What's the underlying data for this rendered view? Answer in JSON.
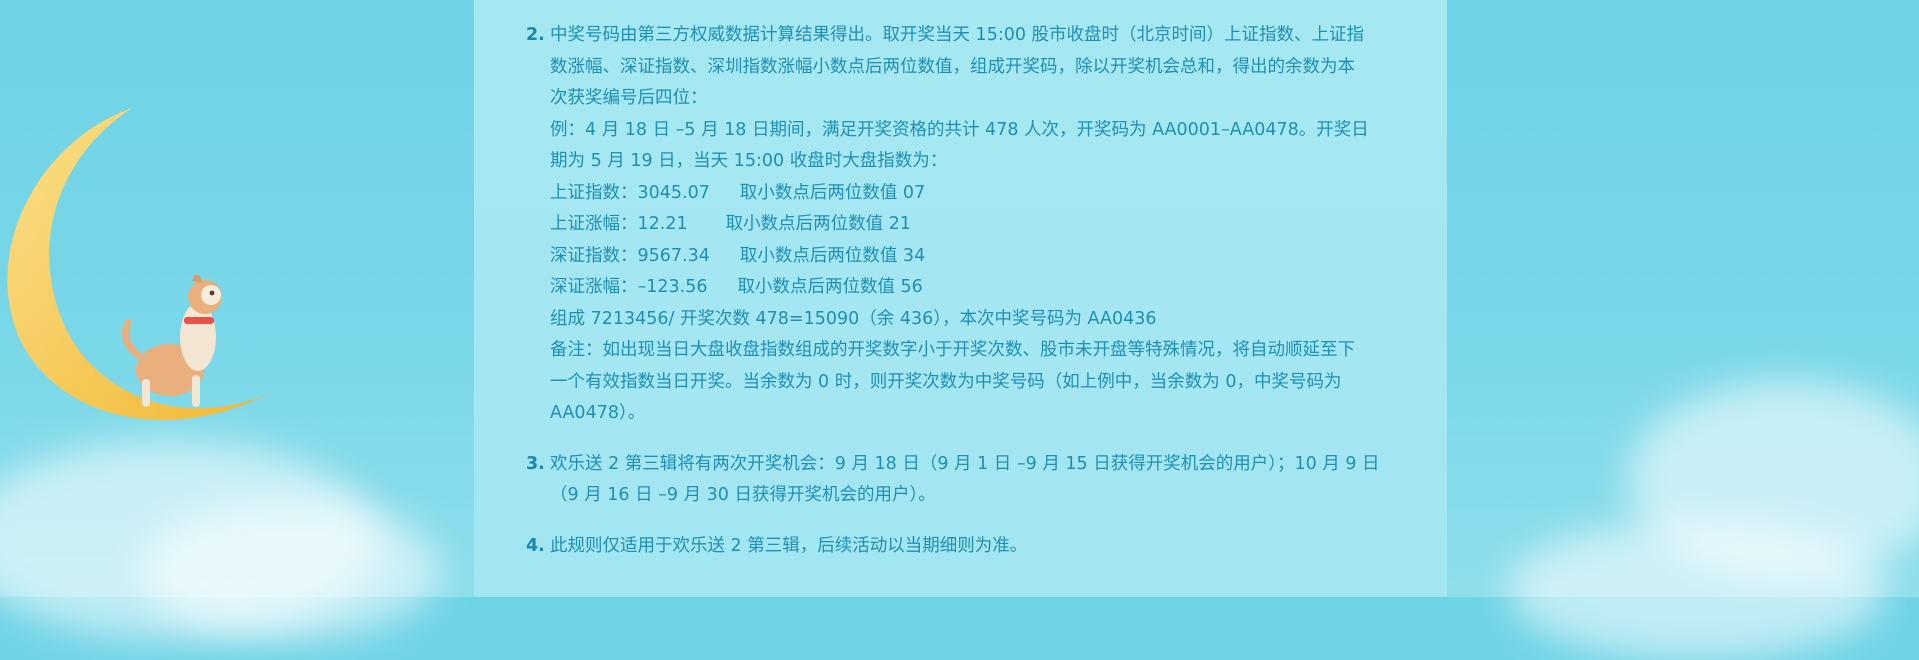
{
  "rules": {
    "r2": {
      "number": "2.",
      "lines": [
        "中奖号码由第三方权威数据计算结果得出。取开奖当天 15:00 股市收盘时（北京时间）上证指数、上证指",
        "数涨幅、深证指数、深圳指数涨幅小数点后两位数值，组成开奖码，除以开奖机会总和，得出的余数为本",
        "次获奖编号后四位：",
        "例：4 月 18 日 –5 月 18 日期间，满足开奖资格的共计 478 人次，开奖码为 AA0001–AA0478。开奖日",
        "期为 5 月 19 日，当天 15:00 收盘时大盘指数为："
      ],
      "index_rows": [
        {
          "label": "上证指数：3045.07",
          "note": "取小数点后两位数值 07"
        },
        {
          "label": "上证涨幅：12.21",
          "note": "取小数点后两位数值 21"
        },
        {
          "label": "深证指数：9567.34",
          "note": "取小数点后两位数值 34"
        },
        {
          "label": "深证涨幅：–123.56",
          "note": "取小数点后两位数值 56"
        }
      ],
      "result": "组成 7213456/ 开奖次数 478=15090（余 436），本次中奖号码为 AA0436",
      "remark": [
        "备注：如出现当日大盘收盘指数组成的开奖数字小于开奖次数、股市未开盘等特殊情况，将自动顺延至下",
        "一个有效指数当日开奖。当余数为 0 时，则开奖次数为中奖号码（如上例中，当余数为 0，中奖号码为",
        "AA0478）。"
      ]
    },
    "r3": {
      "number": "3.",
      "lines": [
        "欢乐送 2 第三辑将有两次开奖机会：9 月 18 日（9 月 1 日 –9 月 15 日获得开奖机会的用户）；10 月 9 日",
        "（9 月 16 日 –9 月 30 日获得开奖机会的用户）。"
      ]
    },
    "r4": {
      "number": "4.",
      "lines": [
        "此规则仅适用于欢乐送 2 第三辑，后续活动以当期细则为准。"
      ]
    }
  },
  "colors": {
    "background": "#78d7e8",
    "panel": "#a4e7f2",
    "text": "#1f8fb5",
    "moon": "#f7cf5a"
  },
  "icons": [
    "crescent-moon-illustration",
    "dog-illustration",
    "cloud-illustration"
  ]
}
